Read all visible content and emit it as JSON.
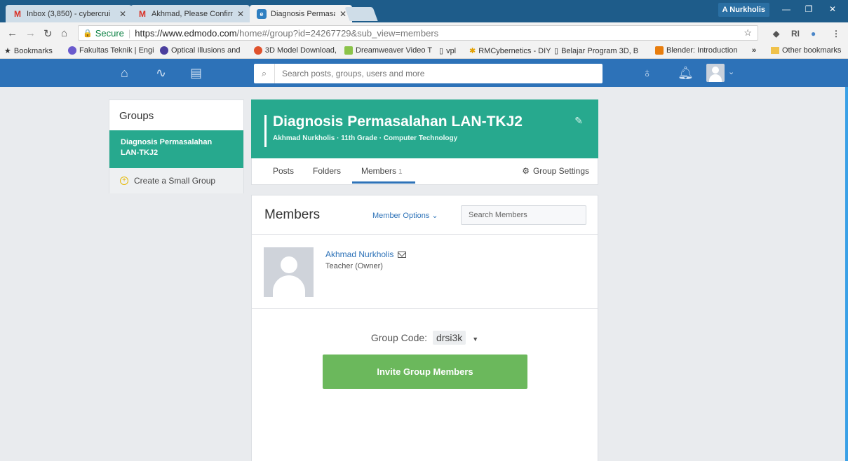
{
  "browser": {
    "tabs": [
      {
        "title": "Inbox (3,850) - cybercrui",
        "icon": "gmail-icon"
      },
      {
        "title": "Akhmad, Please Confirm",
        "icon": "gmail-icon"
      },
      {
        "title": "Diagnosis Permasalahan",
        "icon": "edmodo-icon"
      }
    ],
    "profile_name": "A Nurkholis",
    "secure_label": "Secure",
    "url_host": "https://www.edmodo.com",
    "url_rest": "/home#/group?id=24267729&sub_view=members",
    "bookmarks": [
      "Bookmarks",
      "Fakultas Teknik | Engi",
      "Optical Illusions and",
      "3D Model Download,",
      "Dreamweaver Video T",
      "vpl",
      "RMCybernetics - DIY",
      "Belajar Program 3D, B",
      "Blender: Introduction"
    ],
    "bookmarks_more": "»",
    "other_bookmarks": "Other bookmarks"
  },
  "header": {
    "search_placeholder": "Search posts, groups, users and more"
  },
  "sidebar": {
    "title": "Groups",
    "active_group": "Diagnosis Permasalahan LAN-TKJ2",
    "create_label": "Create a Small Group"
  },
  "group": {
    "name": "Diagnosis Permasalahan LAN-TKJ2",
    "subtitle": "Akhmad Nurkholis · 11th Grade · Computer Technology",
    "tabs": [
      {
        "label": "Posts"
      },
      {
        "label": "Folders"
      },
      {
        "label": "Members",
        "count": "1"
      }
    ],
    "settings_label": "Group Settings"
  },
  "members": {
    "title": "Members",
    "options_label": "Member Options ⌄",
    "search_placeholder": "Search Members",
    "list": [
      {
        "name": "Akhmad Nurkholis",
        "role": "Teacher (Owner)"
      }
    ],
    "group_code_label": "Group Code:",
    "group_code": "drsi3k",
    "invite_label": "Invite Group Members"
  },
  "colors": {
    "header_blue": "#2d72b8",
    "group_green": "#27a98e",
    "invite_green": "#6bb85c"
  }
}
